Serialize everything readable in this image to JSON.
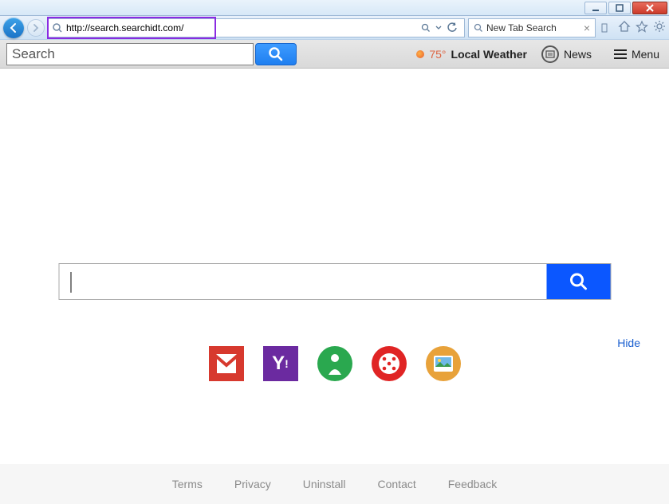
{
  "address_bar": {
    "url": "http://search.searchidt.com/"
  },
  "tab": {
    "title": "New Tab Search"
  },
  "toolbar": {
    "search_placeholder": "Search",
    "weather_temp": "75°",
    "weather_label": "Local Weather",
    "news_label": "News",
    "menu_label": "Menu"
  },
  "main": {
    "hide_label": "Hide"
  },
  "quick_icons": [
    "gmail",
    "yahoo",
    "games",
    "dice",
    "images"
  ],
  "footer": {
    "links": [
      "Terms",
      "Privacy",
      "Uninstall",
      "Contact",
      "Feedback"
    ]
  }
}
